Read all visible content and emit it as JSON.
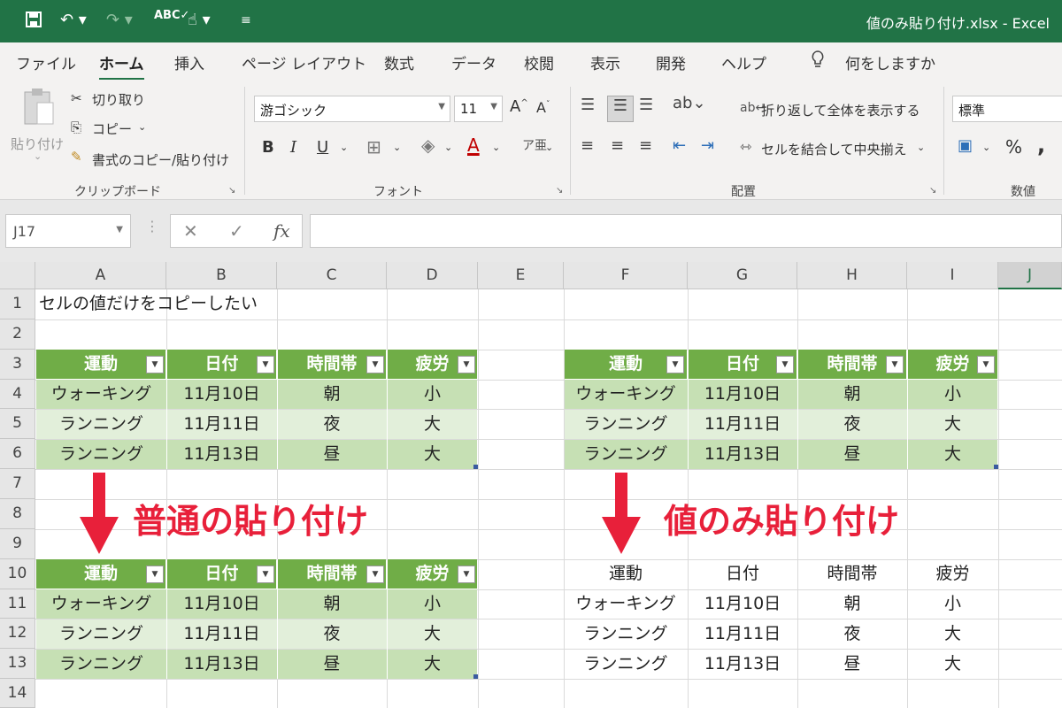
{
  "app": {
    "title": "値のみ貼り付け.xlsx  -  Excel"
  },
  "tabs": [
    "ファイル",
    "ホーム",
    "挿入",
    "ページ レイアウト",
    "数式",
    "データ",
    "校閲",
    "表示",
    "開発",
    "ヘルプ"
  ],
  "active_tab": "ホーム",
  "tell_me": "何をしますか",
  "ribbon": {
    "clipboard": {
      "paste": "貼り付け",
      "cut": "切り取り",
      "copy": "コピー",
      "format_painter": "書式のコピー/貼り付け",
      "group": "クリップボード"
    },
    "font": {
      "name": "游ゴシック",
      "size": "11",
      "bold": "B",
      "italic": "I",
      "underline": "U",
      "group": "フォント"
    },
    "alignment": {
      "wrap": "折り返して全体を表示する",
      "merge": "セルを結合して中央揃え",
      "group": "配置"
    },
    "number": {
      "format": "標準",
      "percent": "%",
      "comma": ",",
      "group": "数値"
    }
  },
  "formula_bar": {
    "name_box": "J17",
    "value": ""
  },
  "columns": [
    "A",
    "B",
    "C",
    "D",
    "E",
    "F",
    "G",
    "H",
    "I",
    "J"
  ],
  "selected_column": "J",
  "rows": [
    "1",
    "2",
    "3",
    "4",
    "5",
    "6",
    "7",
    "8",
    "9",
    "10",
    "11",
    "12",
    "13",
    "14"
  ],
  "cells": {
    "A1": "セルの値だけをコピーしたい",
    "headers": [
      "運動",
      "日付",
      "時間帯",
      "疲労"
    ],
    "data": [
      [
        "ウォーキング",
        "11月10日",
        "朝",
        "小"
      ],
      [
        "ランニング",
        "11月11日",
        "夜",
        "大"
      ],
      [
        "ランニング",
        "11月13日",
        "昼",
        "大"
      ]
    ]
  },
  "annotations": {
    "normal_paste": "普通の貼り付け",
    "values_only_paste": "値のみ貼り付け"
  },
  "colors": {
    "excel_green": "#217346",
    "table_header": "#70ad47",
    "band_dark": "#c6e0b4",
    "band_light": "#e2efda",
    "arrow_red": "#e8203a"
  }
}
